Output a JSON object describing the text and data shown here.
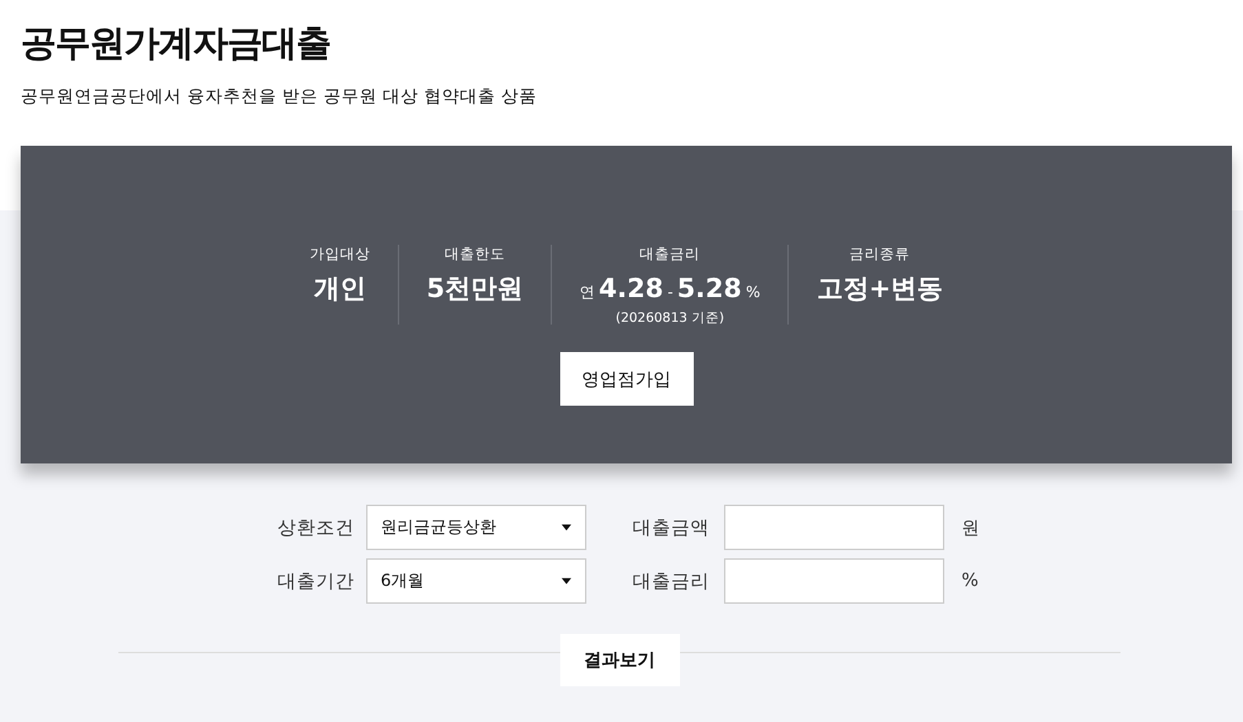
{
  "header": {
    "title": "공무원가계자금대출",
    "subtitle": "공무원연금공단에서 융자추천을 받은 공무원 대상 협약대출 상품"
  },
  "summary": {
    "stats": [
      {
        "kind": "plain",
        "label": "가입대상",
        "value": "개인"
      },
      {
        "kind": "plain",
        "label": "대출한도",
        "value": "5천만원"
      },
      {
        "kind": "range",
        "label": "대출금리",
        "prefix": "연",
        "from": "4.28",
        "separator": "-",
        "to": "5.28",
        "unit": "%",
        "note": "(20260813 기준)"
      },
      {
        "kind": "plain",
        "label": "금리종류",
        "value": "고정+변동"
      }
    ],
    "button": "영업점가입"
  },
  "calculator": {
    "rows": [
      {
        "select_label": "상환조건",
        "select_value": "원리금균등상환",
        "input_label": "대출금액",
        "input_unit": "원"
      },
      {
        "select_label": "대출기간",
        "select_value": "6개월",
        "input_label": "대출금리",
        "input_unit": "%"
      }
    ],
    "button": "결과보기"
  }
}
